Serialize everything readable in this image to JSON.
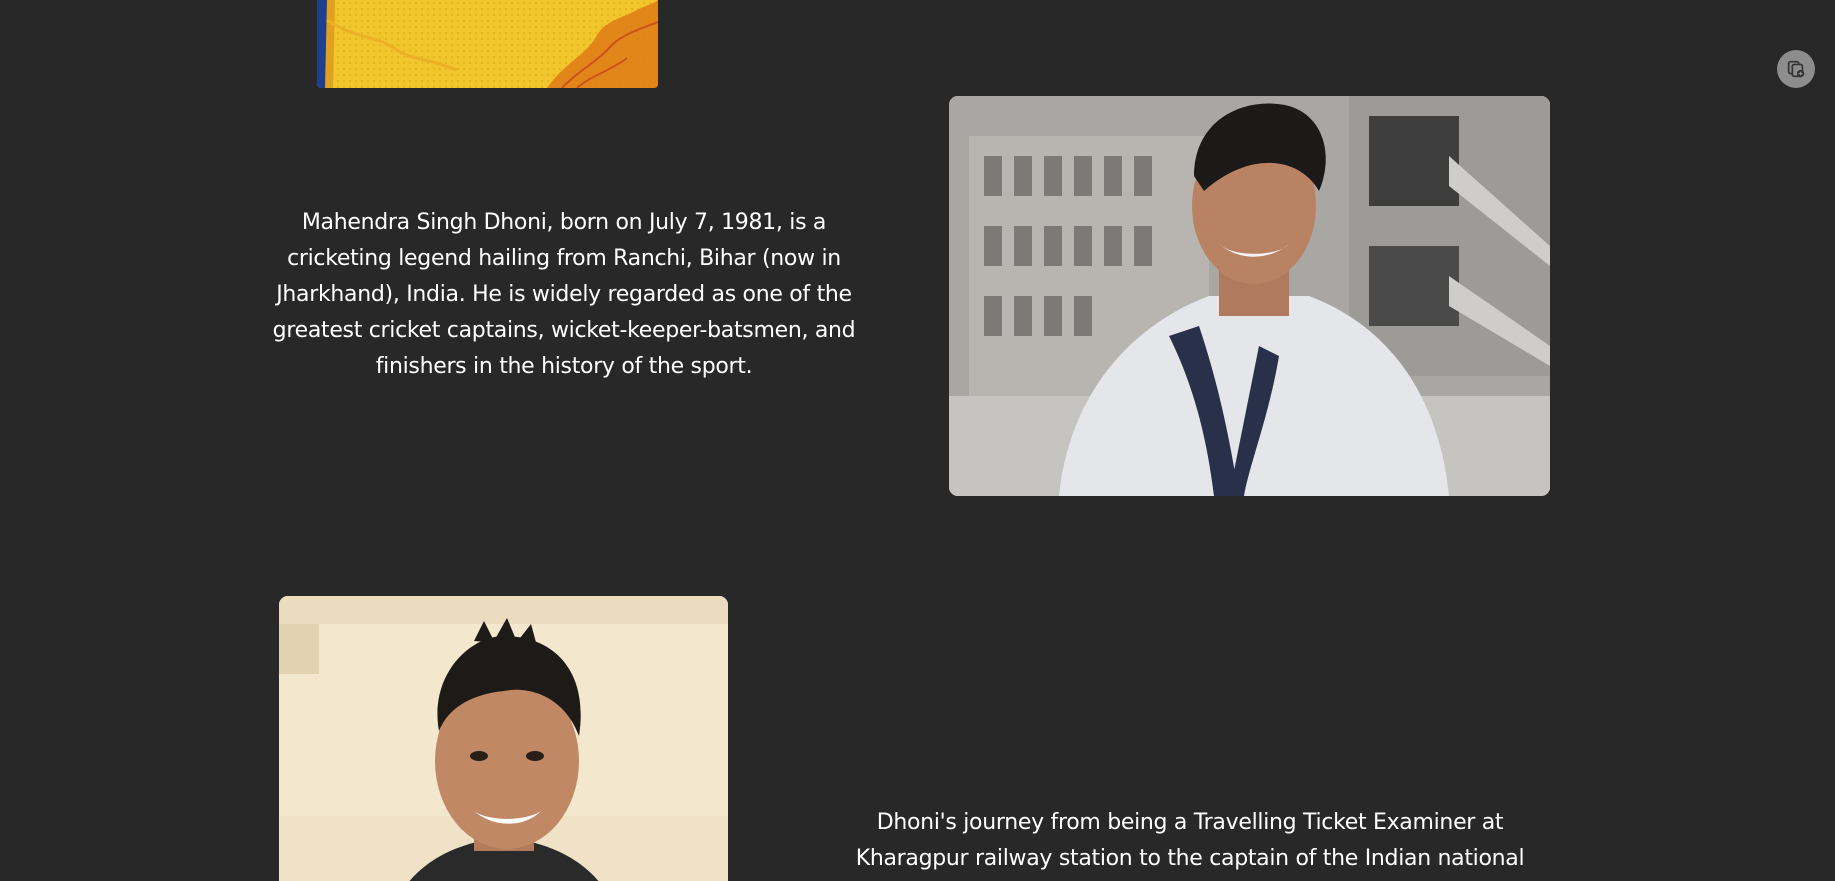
{
  "images": {
    "jersey_icon": "jersey-photo",
    "young_icon": "young-dhoni-photo",
    "adult_icon": "adult-dhoni-photo"
  },
  "floating_button": {
    "icon": "copy-plus-icon"
  },
  "sections": [
    {
      "paragraph": "Mahendra Singh Dhoni, born on July 7, 1981, is a cricketing legend hailing from Ranchi, Bihar (now in Jharkhand), India. He is widely regarded as one of the greatest cricket captains, wicket-keeper-batsmen, and finishers in the history of the sport."
    },
    {
      "paragraph": "Dhoni's journey from being a Travelling Ticket Examiner at Kharagpur railway station to the captain of the Indian national"
    }
  ],
  "colors": {
    "background": "#282828",
    "text": "#ffffff",
    "jersey_yellow": "#f3c62a",
    "float_button": "#8d8d8d"
  }
}
